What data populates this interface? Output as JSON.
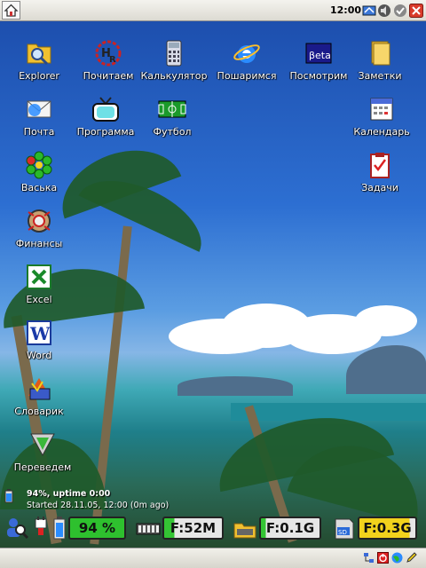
{
  "topbar": {
    "clock": "12:00"
  },
  "desktop_icons": [
    {
      "id": "explorer",
      "label": "Explorer",
      "icon": "explorer-icon"
    },
    {
      "id": "pochitaem",
      "label": "Почитаем",
      "icon": "hr-logo-icon"
    },
    {
      "id": "calculator",
      "label": "Калькулятор",
      "icon": "calculator-icon"
    },
    {
      "id": "browse",
      "label": "Пошаримся",
      "icon": "internet-explorer-icon"
    },
    {
      "id": "watch",
      "label": "Посмотрим",
      "icon": "beta-player-icon",
      "badge": "βeta"
    },
    {
      "id": "notes",
      "label": "Заметки",
      "icon": "notes-icon"
    },
    {
      "id": "mail",
      "label": "Почта",
      "icon": "mail-icon"
    },
    {
      "id": "program",
      "label": "Программа",
      "icon": "tv-icon"
    },
    {
      "id": "football",
      "label": "Футбол",
      "icon": "football-field-icon"
    },
    {
      "id": "calendar",
      "label": "Календарь",
      "icon": "calendar-icon"
    },
    {
      "id": "vaska",
      "label": "Васька",
      "icon": "icq-flower-icon"
    },
    {
      "id": "tasks",
      "label": "Задачи",
      "icon": "tasks-clipboard-icon"
    },
    {
      "id": "finance",
      "label": "Финансы",
      "icon": "finance-icon"
    },
    {
      "id": "excel",
      "label": "Excel",
      "icon": "excel-icon"
    },
    {
      "id": "word",
      "label": "Word",
      "icon": "word-icon"
    },
    {
      "id": "dictionary",
      "label": "Словарик",
      "icon": "dictionary-icon"
    },
    {
      "id": "translate",
      "label": "Переведем",
      "icon": "translate-icon"
    }
  ],
  "status": {
    "line1": "94%, uptime 0:00",
    "line2": "Started 28.11.05, 12:00 (0m ago)"
  },
  "indicators": {
    "battery": "94 %",
    "main_mem": "F:52M",
    "storage1": "F:0.1G",
    "storage2": "F:0.3G"
  },
  "colors": {
    "battery_fill": "#2ec02e",
    "mem_fill": "#34c534",
    "storage_fill": "#e6e6e6",
    "sd_fill": "#f2d21c"
  }
}
